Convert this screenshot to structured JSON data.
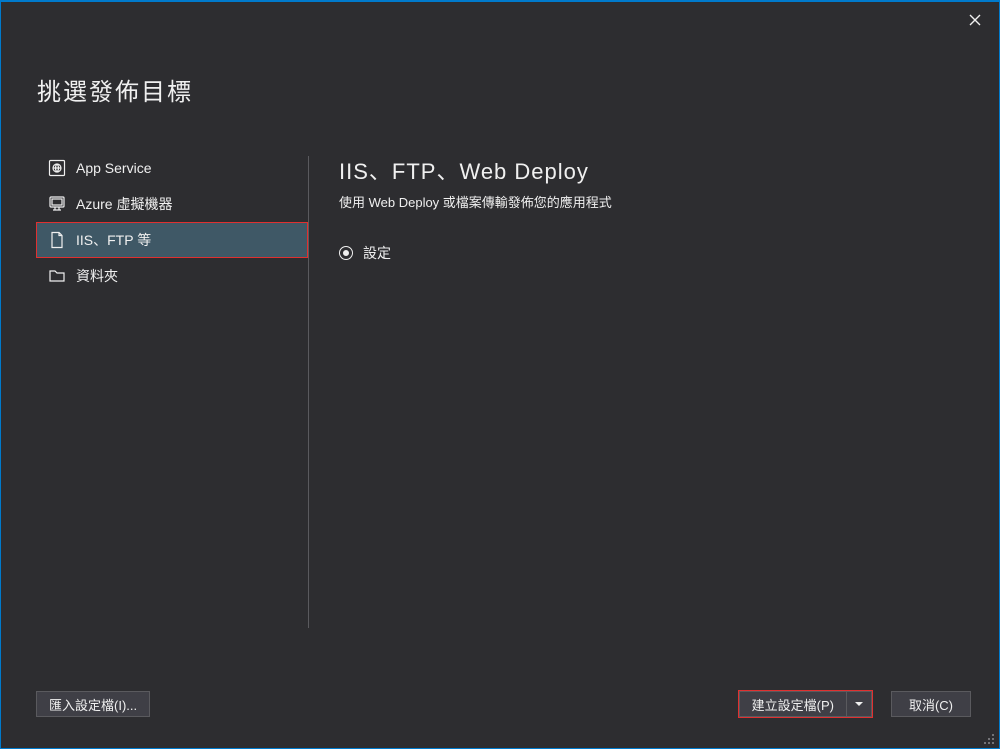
{
  "window": {
    "title": "挑選發佈目標"
  },
  "sidebar": {
    "items": [
      {
        "label": "App Service"
      },
      {
        "label": "Azure 虛擬機器"
      },
      {
        "label": "IIS、FTP 等"
      },
      {
        "label": "資料夾"
      }
    ],
    "selected_index": 2
  },
  "detail": {
    "title": "IIS、FTP、Web Deploy",
    "subtitle": "使用 Web Deploy 或檔案傳輸發佈您的應用程式",
    "radio_group": [
      {
        "label": "設定",
        "checked": true
      }
    ]
  },
  "footer": {
    "import_label": "匯入設定檔(I)...",
    "create_label": "建立設定檔(P)",
    "cancel_label": "取消(C)"
  }
}
